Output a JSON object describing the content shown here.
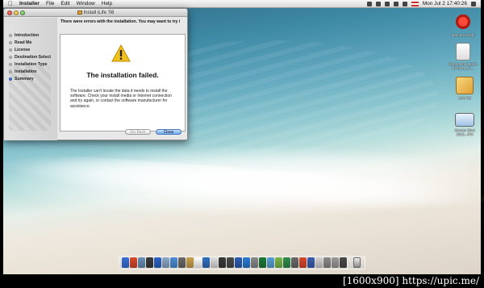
{
  "menubar": {
    "apple": "",
    "app_name": "Installer",
    "menus": [
      "File",
      "Edit",
      "Window",
      "Help"
    ],
    "clock": "Mon Jul 2  17:40:26"
  },
  "installer": {
    "window_title": "Install iLife '08",
    "message_banner": "There were errors with the installation. You may want to try i",
    "steps": [
      {
        "label": "Introduction",
        "active": false
      },
      {
        "label": "Read Me",
        "active": false
      },
      {
        "label": "License",
        "active": false
      },
      {
        "label": "Destination Select",
        "active": false
      },
      {
        "label": "Installation Type",
        "active": false
      },
      {
        "label": "Installation",
        "active": false
      },
      {
        "label": "Summary",
        "active": true
      }
    ],
    "fail_title": "The installation failed.",
    "fail_body": "The Installer can't locate the data it needs to install the software. Check your install media or Internet connection and try again, or contact the software manufacturer for assistance.",
    "go_back_label": "Go Back",
    "close_label": "Close"
  },
  "desktop_icons": [
    {
      "label": "Mac Boot Mini"
    },
    {
      "label": "Screen shot 2012-07-02 at 17..."
    },
    {
      "label": "iLife '08"
    },
    {
      "label": "Screen Shot 2012...PM"
    }
  ],
  "dock": {
    "icon_colors": [
      "#3a6fd6",
      "#d74a2a",
      "#6a8fb8",
      "#3b3b3b",
      "#2b64c8",
      "#8aa9c8",
      "#4b8ed8",
      "#6a6a6a",
      "#c7a24a",
      "#ffffff",
      "#2f6fc0",
      "#e0e0e0",
      "#3a3a3a",
      "#4a4a4a",
      "#2c5db5",
      "#2b7ad8",
      "#8a8a8a",
      "#1f7a3a",
      "#5aa0d8",
      "#7ab84a",
      "#2f8f4a",
      "#6a6a6a",
      "#d84a2a",
      "#3a5fb0",
      "#d4d4d4",
      "#8a8a8a",
      "#9a9a9a",
      "#4a4a4a"
    ]
  },
  "watermark": "[1600x900] https://upic.me/"
}
